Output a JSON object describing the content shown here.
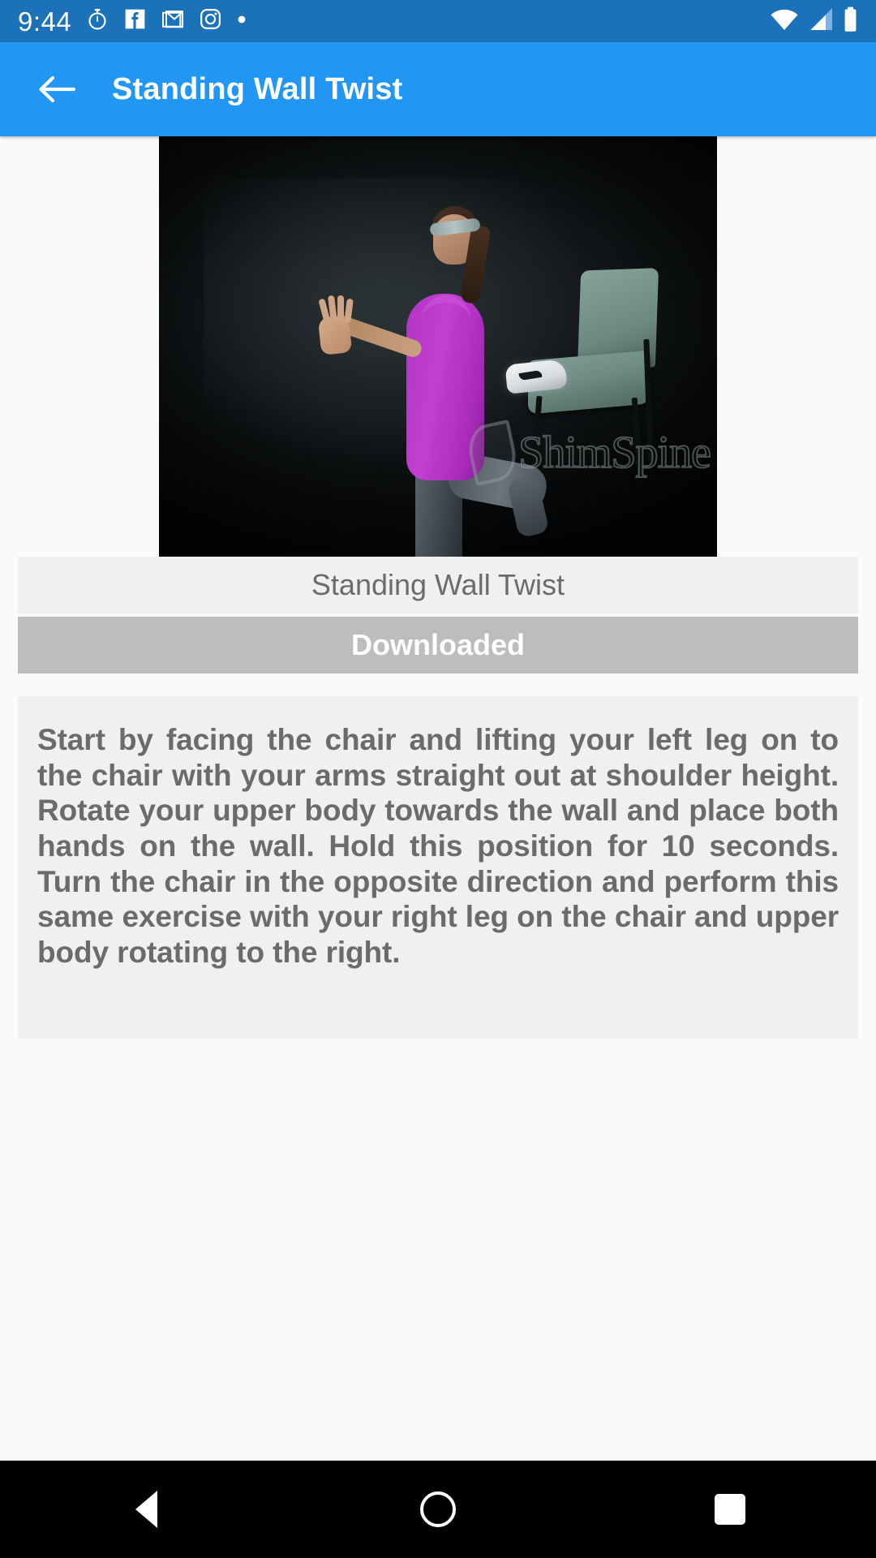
{
  "status_bar": {
    "time": "9:44",
    "background_color": "#1c72b8",
    "left_icons": [
      {
        "name": "stopwatch-icon",
        "label": "Clock"
      },
      {
        "name": "facebook-icon",
        "label": "Facebook"
      },
      {
        "name": "gmail-icon",
        "label": "Gmail"
      },
      {
        "name": "instagram-icon",
        "label": "Instagram"
      },
      {
        "name": "more-notifications-dot-icon",
        "label": "More notifications"
      }
    ],
    "right_icons": [
      {
        "name": "wifi-icon",
        "label": "Wi-Fi"
      },
      {
        "name": "cellular-signal-icon",
        "label": "Mobile signal"
      },
      {
        "name": "battery-icon",
        "label": "Battery"
      }
    ]
  },
  "app_bar": {
    "title": "Standing Wall Twist",
    "back_icon": "back-arrow-icon",
    "background_color": "#2196f3",
    "text_color": "#ffffff"
  },
  "exercise": {
    "image_caption": "Standing Wall Twist",
    "watermark": "ShimSpine",
    "download_button_label": "Downloaded",
    "download_button_color": "#bdbdbd",
    "caption_background_color": "#f0f0f0",
    "description": "Start by facing the chair and lifting your left leg on to the chair with your arms straight out at shoulder height. Rotate your upper body towards the wall and place both hands on the wall. Hold this position for 10 seconds. Turn the chair in the opposite direction and perform this same exercise with your right leg on the chair and upper body rotating to the right."
  },
  "nav_bar": {
    "background_color": "#000000",
    "buttons": [
      {
        "name": "nav-back-button",
        "label": "Back"
      },
      {
        "name": "nav-home-button",
        "label": "Home"
      },
      {
        "name": "nav-recents-button",
        "label": "Recents"
      }
    ]
  }
}
